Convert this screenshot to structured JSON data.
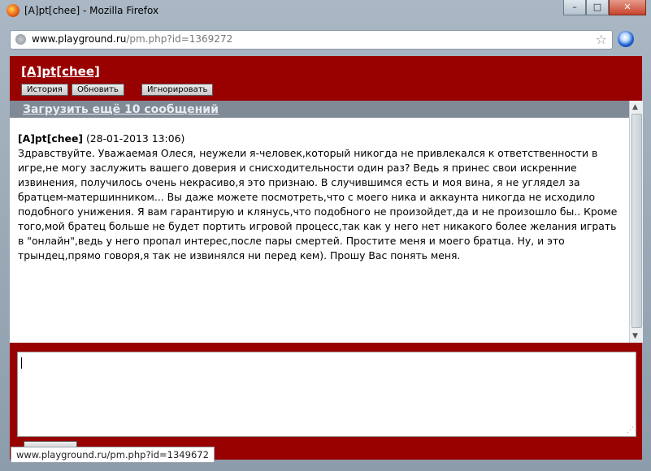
{
  "window": {
    "title": "[A]pt[chee] - Mozilla Firefox",
    "minimize": "–",
    "maximize": "□",
    "close": "✕"
  },
  "address": {
    "domain": "www.playground.ru",
    "path": "/pm.php?id=1369272"
  },
  "pm": {
    "title": "[A]pt[chee]",
    "buttons": {
      "history": "История",
      "refresh": "Обновить",
      "ignore": "Игнорировать"
    },
    "load_more": "Загрузить ещё 10 сообщений",
    "message": {
      "author": "[A]pt[chee]",
      "date": "(28-01-2013 13:06)",
      "text": "Здравствуйте. Уважаемая Олеся, неужели я-человек,который никогда не привлекался к ответственности в игре,не могу заслужить вашего доверия и снисходительности один раз? Ведь я принес свои искренние извинения, получилось очень некрасиво,я это признаю. В случившимся есть и моя вина, я не углядел за братцем-матершинником... Вы даже можете посмотреть,что с моего ника и аккаунта никогда не исходило подобного унижения. Я вам гарантирую и клянусь,что подобного не произойдет,да и не произошло бы.. Кроме того,мой братец больше не будет портить игровой процесс,так как у него нет никакого более желания играть в \"онлайн\",ведь у него пропал интерес,после пары смертей. Простите меня и моего братца. Ну, и это трындец,прямо говоря,я так не извинялся ни перед кем). Прошу Вас понять меня."
    },
    "reply_value": ""
  },
  "statusbar": {
    "link": "www.playground.ru/pm.php?id=1349672"
  },
  "colors": {
    "brand_red": "#990000",
    "load_bar": "#7f8a96"
  }
}
